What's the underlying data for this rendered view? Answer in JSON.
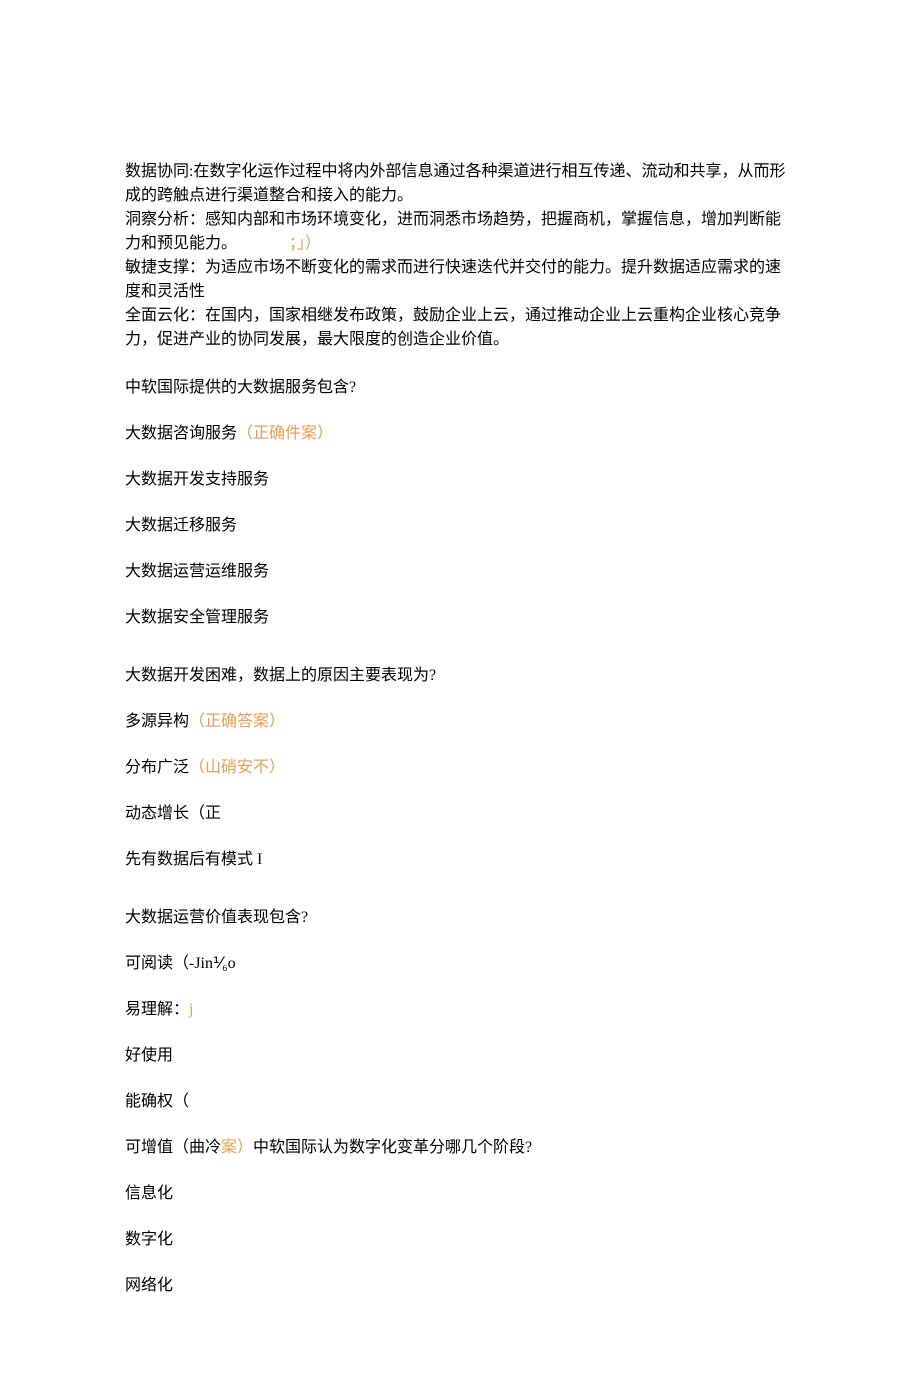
{
  "definitions": {
    "data_sync": "数据协同:在数字化运作过程中将内外部信息通过各种渠道进行相互传递、流动和共享，从而形成的跨触点进行渠道整合和接入的能力。",
    "insight_prefix": "洞察分析：感知内部和市场环境变化，进而洞悉市场趋势，把握商机，掌握信息，增加判断能力和预见能力。",
    "insight_suffix": "；」）",
    "agile": "敏捷支撑：为适应市场不断变化的需求而进行快速迭代并交付的能力。提升数据适应需求的速度和灵活性",
    "cloud": "全面云化：在国内，国家相继发布政策，鼓励企业上云，通过推动企业上云重构企业核心竞争力，促进产业的协同发展，最大限度的创造企业价值。"
  },
  "q1": {
    "question": "中软国际提供的大数据服务包含?",
    "opt1_text": "大数据咨询服务",
    "opt1_mark": "（正确件案）",
    "opt2": "大数据开发支持服务",
    "opt3": "大数据迁移服务",
    "opt4": "大数据运营运维服务",
    "opt5": "大数据安全管理服务"
  },
  "q2": {
    "question": "大数据开发困难，数据上的原因主要表现为?",
    "opt1_text": "多源异构",
    "opt1_mark": "（正确答案）",
    "opt2_text": "分布广泛",
    "opt2_mark": "（山硝安不）",
    "opt3": "动态增长（正",
    "opt4": "先有数据后有模式 I"
  },
  "q3": {
    "question": "大数据运营价值表现包含?",
    "opt1": "可阅读（-Jin⅟₆o",
    "opt2_text": "易理解：",
    "opt2_mark": "j",
    "opt3": "好使用",
    "opt4": "能确权（",
    "opt5_prefix": "可增值（曲冷",
    "opt5_mark": "案）",
    "opt5_suffix": "中软国际认为数字化变革分哪几个阶段?",
    "opt6": "信息化",
    "opt7": "数字化",
    "opt8": "网络化"
  }
}
